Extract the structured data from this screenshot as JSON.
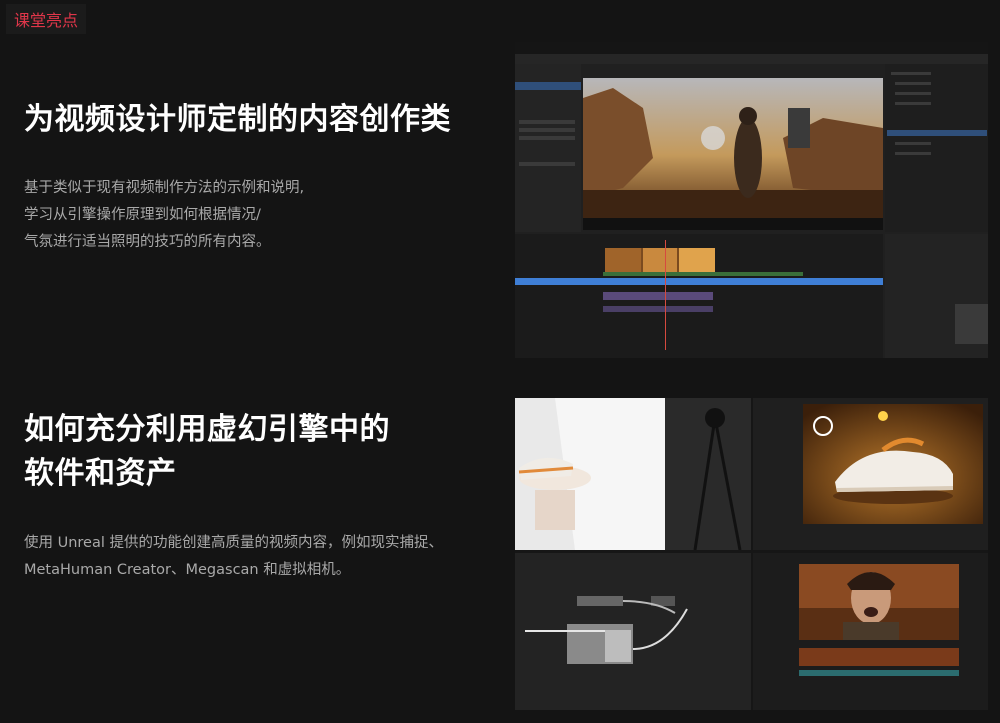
{
  "header": {
    "tag": "课堂亮点"
  },
  "section1": {
    "title_lines": [
      "为视频设计师定制的内容创作类"
    ],
    "desc_lines": [
      "基于类似于现有视频制作方法的示例和说明,",
      "学习从引擎操作原理到如何根据情况/",
      "气氛进行适当照明的技巧的所有内容。"
    ]
  },
  "section2": {
    "title_lines": [
      "如何充分利用虚幻引擎中的",
      "软件和资产"
    ],
    "desc_lines": [
      "使用 Unreal 提供的功能创建高质量的视频内容，例如现实捕捉、",
      "MetaHuman Creator、Megascan 和虚拟相机。"
    ]
  },
  "colors": {
    "accent": "#e0364a",
    "background": "#141414",
    "timeline_blue": "#3f7fd6"
  }
}
